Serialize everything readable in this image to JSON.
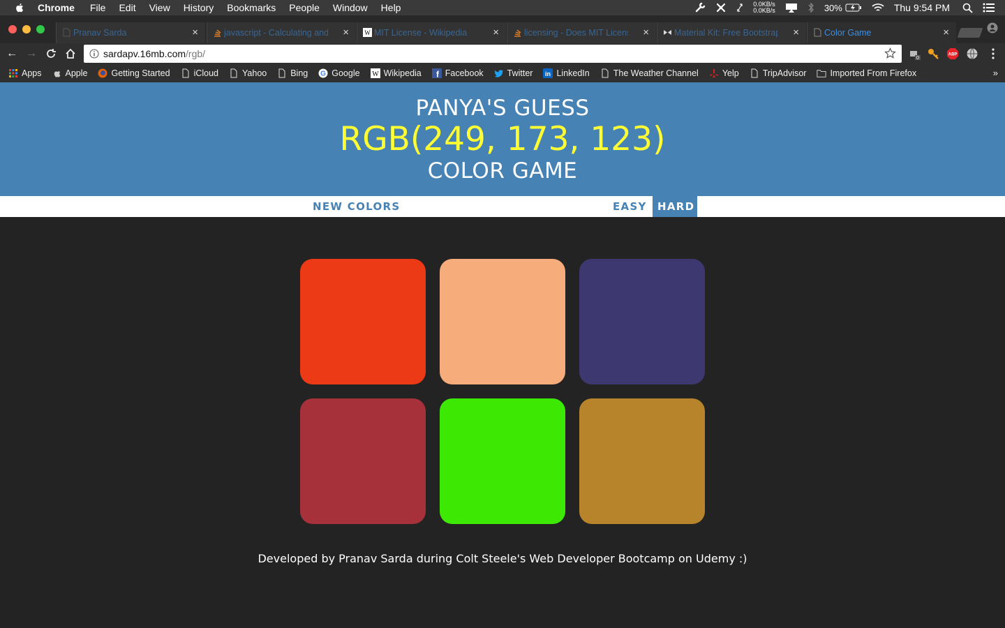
{
  "menubar": {
    "app_name": "Chrome",
    "items": [
      "File",
      "Edit",
      "View",
      "History",
      "Bookmarks",
      "People",
      "Window",
      "Help"
    ],
    "net_up": "0.0KB/s",
    "net_down": "0.0KB/s",
    "battery": "30%",
    "clock": "Thu 9:54 PM"
  },
  "tabs": [
    {
      "title": "Pranav Sarda",
      "icon": "page-icon",
      "active": false
    },
    {
      "title": "javascript - Calculating and",
      "icon": "stackoverflow-icon",
      "active": false
    },
    {
      "title": "MIT License - Wikipedia",
      "icon": "wikipedia-icon",
      "active": false
    },
    {
      "title": "licensing - Does MIT Licens",
      "icon": "stackoverflow-icon",
      "active": false
    },
    {
      "title": "Material Kit: Free Bootstrap",
      "icon": "bowtie-icon",
      "active": false
    },
    {
      "title": "Color Game",
      "icon": "page-icon",
      "active": true
    }
  ],
  "address_bar": {
    "host": "sardapv.16mb.com",
    "path": "/rgb/"
  },
  "bookmarks": [
    {
      "label": "Apps",
      "icon": "apps-grid-icon"
    },
    {
      "label": "Apple",
      "icon": "apple-icon"
    },
    {
      "label": "Getting Started",
      "icon": "firefox-icon"
    },
    {
      "label": "iCloud",
      "icon": "page-icon"
    },
    {
      "label": "Yahoo",
      "icon": "page-icon"
    },
    {
      "label": "Bing",
      "icon": "page-icon"
    },
    {
      "label": "Google",
      "icon": "google-icon"
    },
    {
      "label": "Wikipedia",
      "icon": "wikipedia-icon"
    },
    {
      "label": "Facebook",
      "icon": "facebook-icon"
    },
    {
      "label": "Twitter",
      "icon": "twitter-icon"
    },
    {
      "label": "LinkedIn",
      "icon": "linkedin-icon"
    },
    {
      "label": "The Weather Channel",
      "icon": "page-icon"
    },
    {
      "label": "Yelp",
      "icon": "yelp-icon"
    },
    {
      "label": "TripAdvisor",
      "icon": "page-icon"
    },
    {
      "label": "Imported From Firefox",
      "icon": "folder-icon"
    }
  ],
  "bookmarks_more": "»",
  "game": {
    "line1": "PANYA'S GUESS",
    "target_rgb": "RGB(249, 173, 123)",
    "line3": "COLOR GAME",
    "new_colors_label": "NEW COLORS",
    "easy_label": "EASY",
    "hard_label": "HARD",
    "selected_mode": "HARD",
    "header_color": "#4682b4",
    "target_text_color": "#ffff33",
    "squares": [
      {
        "color": "#ec3a17"
      },
      {
        "color": "#f7ad7b"
      },
      {
        "color": "#3e3871"
      },
      {
        "color": "#a6313a"
      },
      {
        "color": "#3de803"
      },
      {
        "color": "#b8842b"
      }
    ],
    "footer": "Developed by Pranav Sarda during Colt Steele's Web Developer Bootcamp on Udemy :)"
  }
}
